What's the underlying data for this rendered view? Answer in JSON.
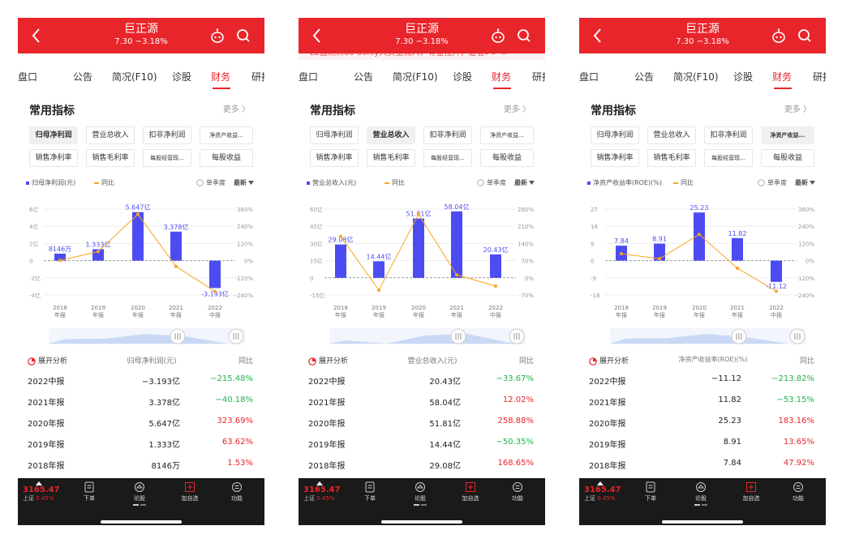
{
  "colors": {
    "red": "#e8252a",
    "green": "#1fb44b",
    "bar": "#4d4cf2",
    "line": "#f5a623"
  },
  "screens": [
    {
      "header": {
        "title": "巨正源",
        "subtitle": "7.30 −3.18%"
      },
      "banner": "",
      "tabs": [
        "盘口",
        "公告",
        "简况(F10)",
        "诊股",
        "财务",
        "研报"
      ],
      "active_tab": 4,
      "section_title": "常用指标",
      "more": "更多 〉",
      "chips": [
        "归母净利润",
        "营业总收入",
        "扣非净利润",
        "净资产收益...",
        "销售净利率",
        "销售毛利率",
        "每股经营现...",
        "每股收益"
      ],
      "selected_chip": 0,
      "legend": {
        "bar": "归母净利润(元)",
        "line": "同比",
        "quarter": "单季度",
        "latest": "最新"
      },
      "x_labels": [
        [
          "2018",
          "年报"
        ],
        [
          "2019",
          "年报"
        ],
        [
          "2020",
          "年报"
        ],
        [
          "2021",
          "年报"
        ],
        [
          "2022",
          "中报"
        ]
      ],
      "table": {
        "header": {
          "expand": "展开分析",
          "metric": "归母净利润(元)",
          "yoy": "同比"
        },
        "rows": [
          {
            "period": "2022中报",
            "value": "−3.193亿",
            "yoy": "−215.48%"
          },
          {
            "period": "2021年报",
            "value": "3.378亿",
            "yoy": "−40.18%"
          },
          {
            "period": "2020年报",
            "value": "5.647亿",
            "yoy": "323.69%"
          },
          {
            "period": "2019年报",
            "value": "1.333亿",
            "yoy": "63.62%"
          },
          {
            "period": "2018年报",
            "value": "8146万",
            "yoy": "1.53%"
          }
        ]
      }
    },
    {
      "header": {
        "title": "巨正源",
        "subtitle": "7.30 −3.18%"
      },
      "banner": "L2监测到60    0only大资金流入，有望拉升，速看>>   ×",
      "tabs": [
        "盘口",
        "公告",
        "简况(F10)",
        "诊股",
        "财务",
        "研报"
      ],
      "active_tab": 4,
      "section_title": "常用指标",
      "more": "更多 〉",
      "chips": [
        "归母净利润",
        "营业总收入",
        "扣非净利润",
        "净资产收益...",
        "销售净利率",
        "销售毛利率",
        "每股经营现...",
        "每股收益"
      ],
      "selected_chip": 1,
      "legend": {
        "bar": "营业总收入(元)",
        "line": "同比",
        "quarter": "单季度",
        "latest": "最新"
      },
      "x_labels": [
        [
          "2018",
          "年报"
        ],
        [
          "2019",
          "年报"
        ],
        [
          "2020",
          "年报"
        ],
        [
          "2021",
          "年报"
        ],
        [
          "2022",
          "中报"
        ]
      ],
      "table": {
        "header": {
          "expand": "展开分析",
          "metric": "营业总收入(元)",
          "yoy": "同比"
        },
        "rows": [
          {
            "period": "2022中报",
            "value": "20.43亿",
            "yoy": "−33.67%"
          },
          {
            "period": "2021年报",
            "value": "58.04亿",
            "yoy": "12.02%"
          },
          {
            "period": "2020年报",
            "value": "51.81亿",
            "yoy": "258.88%"
          },
          {
            "period": "2019年报",
            "value": "14.44亿",
            "yoy": "−50.35%"
          },
          {
            "period": "2018年报",
            "value": "29.08亿",
            "yoy": "168.65%"
          }
        ]
      }
    },
    {
      "header": {
        "title": "巨正源",
        "subtitle": "7.30 −3.18%"
      },
      "banner": "",
      "tabs": [
        "盘口",
        "公告",
        "简况(F10)",
        "诊股",
        "财务",
        "研报"
      ],
      "active_tab": 4,
      "section_title": "常用指标",
      "more": "更多 〉",
      "chips": [
        "归母净利润",
        "营业总收入",
        "扣非净利润",
        "净资产收益...",
        "销售净利率",
        "销售毛利率",
        "每股经营现...",
        "每股收益"
      ],
      "selected_chip": 3,
      "legend": {
        "bar": "净资产收益率(ROE)(%)",
        "line": "同比",
        "quarter": "单季度",
        "latest": "最新"
      },
      "x_labels": [
        [
          "2018",
          "年报"
        ],
        [
          "2019",
          "年报"
        ],
        [
          "2020",
          "年报"
        ],
        [
          "2021",
          "年报"
        ],
        [
          "2022",
          "中报"
        ]
      ],
      "table": {
        "header": {
          "expand": "展开分析",
          "metric": "净资产收益率(ROE)(%)",
          "yoy": "同比"
        },
        "rows": [
          {
            "period": "2022中报",
            "value": "−11.12",
            "yoy": "−213.82%"
          },
          {
            "period": "2021年报",
            "value": "11.82",
            "yoy": "−53.15%"
          },
          {
            "period": "2020年报",
            "value": "25.23",
            "yoy": "183.16%"
          },
          {
            "period": "2019年报",
            "value": "8.91",
            "yoy": "13.65%"
          },
          {
            "period": "2018年报",
            "value": "7.84",
            "yoy": "47.92%"
          }
        ]
      }
    }
  ],
  "chart_data": [
    {
      "type": "bar",
      "categories": [
        "2018年报",
        "2019年报",
        "2020年报",
        "2021年报",
        "2022中报"
      ],
      "series": [
        {
          "name": "归母净利润(元)",
          "values": [
            0.8146,
            1.333,
            5.647,
            3.378,
            -3.193
          ],
          "labels": [
            "8146万",
            "1.333亿",
            "5.647亿",
            "3.378亿",
            "-3.193亿"
          ]
        },
        {
          "name": "同比",
          "values": [
            1.53,
            63.62,
            323.69,
            -40.18,
            -215.48
          ]
        }
      ],
      "y_left_ticks": [
        "6亿",
        "4亿",
        "2亿",
        "0",
        "-2亿",
        "-4亿"
      ],
      "y_right_ticks": [
        "360%",
        "240%",
        "120%",
        "0%",
        "-120%",
        "-240%"
      ],
      "ylim_left": [
        -4,
        6
      ],
      "ylim_right": [
        -240,
        360
      ]
    },
    {
      "type": "bar",
      "categories": [
        "2018年报",
        "2019年报",
        "2020年报",
        "2021年报",
        "2022中报"
      ],
      "series": [
        {
          "name": "营业总收入(元)",
          "values": [
            29.08,
            14.44,
            51.81,
            58.04,
            20.43
          ],
          "labels": [
            "29.08亿",
            "14.44亿",
            "51.81亿",
            "58.04亿",
            "20.43亿"
          ]
        },
        {
          "name": "同比",
          "values": [
            168.65,
            -50.35,
            258.88,
            12.02,
            -33.67
          ]
        }
      ],
      "y_left_ticks": [
        "60亿",
        "45亿",
        "30亿",
        "15亿",
        "0",
        "-15亿"
      ],
      "y_right_ticks": [
        "280%",
        "210%",
        "140%",
        "70%",
        "0%",
        "-70%"
      ],
      "ylim_left": [
        -15,
        60
      ],
      "ylim_right": [
        -70,
        280
      ]
    },
    {
      "type": "bar",
      "categories": [
        "2018年报",
        "2019年报",
        "2020年报",
        "2021年报",
        "2022中报"
      ],
      "series": [
        {
          "name": "净资产收益率(ROE)(%)",
          "values": [
            7.84,
            8.91,
            25.23,
            11.82,
            -11.12
          ],
          "labels": [
            "7.84",
            "8.91",
            "25.23",
            "11.82",
            "-11.12"
          ]
        },
        {
          "name": "同比",
          "values": [
            47.92,
            13.65,
            183.16,
            -53.15,
            -213.82
          ]
        }
      ],
      "y_left_ticks": [
        "27",
        "18",
        "9",
        "0",
        "-9",
        "-18"
      ],
      "y_right_ticks": [
        "360%",
        "240%",
        "120%",
        "0%",
        "-120%",
        "-240%"
      ],
      "ylim_left": [
        -18,
        27
      ],
      "ylim_right": [
        -240,
        360
      ]
    }
  ],
  "tabbar": {
    "index_value": "3165.47",
    "index_name": "上证",
    "index_change": "0.45%",
    "items": [
      "下单",
      "论股",
      "加自选",
      "功能"
    ]
  }
}
